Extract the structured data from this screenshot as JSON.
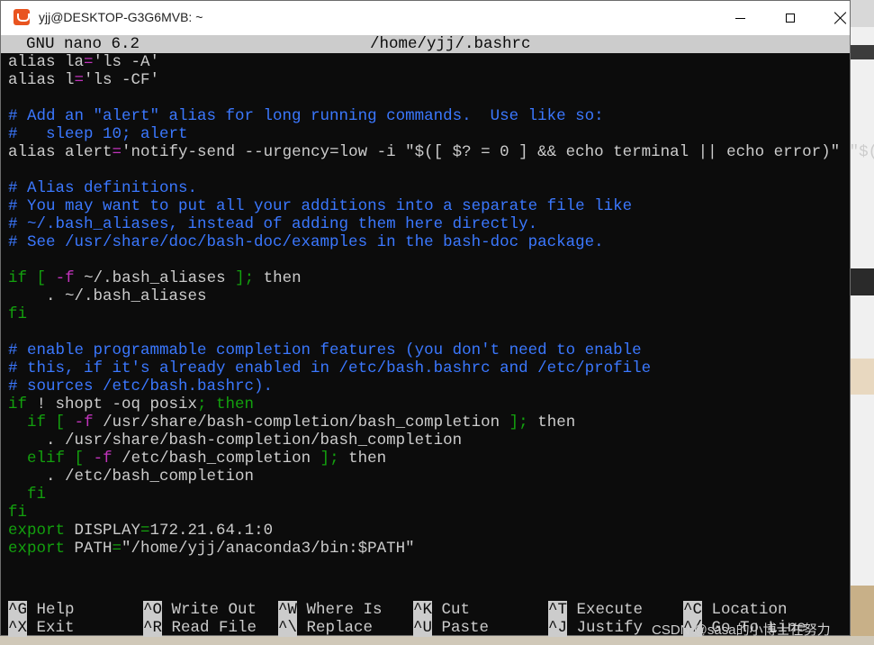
{
  "window": {
    "title": "yjj@DESKTOP-G3G6MVB: ~"
  },
  "nano": {
    "version": "GNU nano 6.2",
    "filename": "/home/yjj/.bashrc"
  },
  "lines": [
    "alias la='ls -A'",
    "alias l='ls -CF'",
    "",
    "# Add an \"alert\" alias for long running commands.  Use like so:",
    "#   sleep 10; alert",
    "alias alert='notify-send --urgency=low -i \"$([ $? = 0 ] && echo terminal || echo error)\" \"$(",
    "",
    "# Alias definitions.",
    "# You may want to put all your additions into a separate file like",
    "# ~/.bash_aliases, instead of adding them here directly.",
    "# See /usr/share/doc/bash-doc/examples in the bash-doc package.",
    "",
    "if [ -f ~/.bash_aliases ]; then",
    "    . ~/.bash_aliases",
    "fi",
    "",
    "# enable programmable completion features (you don't need to enable",
    "# this, if it's already enabled in /etc/bash.bashrc and /etc/profile",
    "# sources /etc/bash.bashrc).",
    "if ! shopt -oq posix; then",
    "  if [ -f /usr/share/bash-completion/bash_completion ]; then",
    "    . /usr/share/bash-completion/bash_completion",
    "  elif [ -f /etc/bash_completion ]; then",
    "    . /etc/bash_completion",
    "  fi",
    "fi",
    "export DISPLAY=172.21.64.1:0",
    "export PATH=\"/home/yjj/anaconda3/bin:$PATH\""
  ],
  "overflow_marker": ">",
  "shortcuts": [
    {
      "key": "^G",
      "label": "Help"
    },
    {
      "key": "^O",
      "label": "Write Out"
    },
    {
      "key": "^W",
      "label": "Where Is"
    },
    {
      "key": "^K",
      "label": "Cut"
    },
    {
      "key": "^T",
      "label": "Execute"
    },
    {
      "key": "^C",
      "label": "Location"
    },
    {
      "key": "^X",
      "label": "Exit"
    },
    {
      "key": "^R",
      "label": "Read File"
    },
    {
      "key": "^\\",
      "label": "Replace"
    },
    {
      "key": "^U",
      "label": "Paste"
    },
    {
      "key": "^J",
      "label": "Justify"
    },
    {
      "key": "^/",
      "label": "Go To Line"
    }
  ],
  "watermark": "CSDN @sasa的小博士在努力",
  "colors": {
    "terminal_bg": "#0c0c0c",
    "text": "#cccccc",
    "comment": "#3b78ff",
    "keyword": "#13a10e",
    "operator": "#c133bb"
  },
  "icons": {
    "app": "ubuntu-terminal-icon",
    "minimize": "minimize-icon",
    "maximize": "maximize-icon",
    "close": "close-icon"
  }
}
